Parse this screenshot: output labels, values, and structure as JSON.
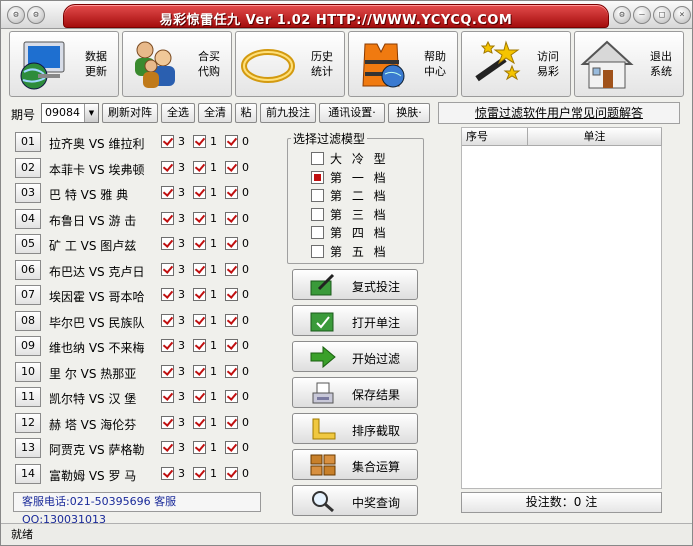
{
  "window": {
    "title": "易彩惊雷任九 Ver 1.02  HTTP://WWW.YCYCQ.COM"
  },
  "toolbar": [
    {
      "label1": "数据",
      "label2": "更新",
      "icon": "monitor-globe-icon"
    },
    {
      "label1": "合买",
      "label2": "代购",
      "icon": "users-icon"
    },
    {
      "label1": "历史",
      "label2": "统计",
      "icon": "gold-ring-icon"
    },
    {
      "label1": "帮助",
      "label2": "中心",
      "icon": "life-vest-icon"
    },
    {
      "label1": "访问",
      "label2": "易彩",
      "icon": "magic-wand-icon"
    },
    {
      "label1": "退出",
      "label2": "系统",
      "icon": "house-icon"
    }
  ],
  "controls": {
    "period_label": "期号",
    "period_value": "09084",
    "refresh": "刷新对阵",
    "select_all": "全选",
    "clear_all": "全清",
    "paste": "粘",
    "top_nine": "前九投注",
    "comm_settings": "通讯设置·",
    "skin": "换肤·",
    "faq": "惊雷过滤软件用户常见问题解答"
  },
  "matches": [
    {
      "num": "01",
      "name": "拉齐奥 VS 维拉利"
    },
    {
      "num": "02",
      "name": "本菲卡 VS 埃弗顿"
    },
    {
      "num": "03",
      "name": "巴  特 VS 雅  典"
    },
    {
      "num": "04",
      "name": "布鲁日 VS 游  击"
    },
    {
      "num": "05",
      "name": "矿  工 VS 图卢兹"
    },
    {
      "num": "06",
      "name": "布巴达 VS 克卢日"
    },
    {
      "num": "07",
      "name": "埃因霍 VS 哥本哈"
    },
    {
      "num": "08",
      "name": "毕尔巴 VS 民族队"
    },
    {
      "num": "09",
      "name": "维也纳 VS 不来梅"
    },
    {
      "num": "10",
      "name": "里  尔 VS 热那亚"
    },
    {
      "num": "11",
      "name": "凯尔特 VS 汉  堡"
    },
    {
      "num": "12",
      "name": "赫  塔 VS 海伦芬"
    },
    {
      "num": "13",
      "name": "阿贾克 VS 萨格勒"
    },
    {
      "num": "14",
      "name": "富勒姆 VS 罗  马"
    }
  ],
  "options": {
    "win": "3",
    "draw": "1",
    "lose": "0"
  },
  "filter_model": {
    "title": "选择过滤模型",
    "items": [
      "大 冷 型",
      "第 一 档",
      "第 二 档",
      "第 三 档",
      "第 四 档",
      "第 五 档"
    ],
    "selected_index": 1
  },
  "actions": [
    {
      "label": "复式投注",
      "icon": "pen-ticket-icon"
    },
    {
      "label": "打开单注",
      "icon": "open-ticket-icon"
    },
    {
      "label": "开始过滤",
      "icon": "arrow-right-icon"
    },
    {
      "label": "保存结果",
      "icon": "save-disk-icon"
    },
    {
      "label": "排序截取",
      "icon": "sort-crop-icon"
    },
    {
      "label": "集合运算",
      "icon": "grid-blocks-icon"
    },
    {
      "label": "中奖查询",
      "icon": "magnifier-icon"
    }
  ],
  "list": {
    "col_index": "序号",
    "col_bet": "单注"
  },
  "bet_count": "投注数：0 注",
  "service": "客服电话:021-50395696  客服QQ:130031013",
  "status": "就绪"
}
